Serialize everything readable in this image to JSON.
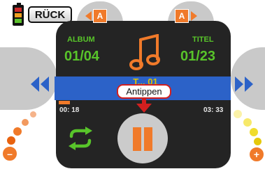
{
  "top": {
    "back_label": "RÜCK",
    "album_nav_label": "A",
    "title_nav_label": "A"
  },
  "info": {
    "album_label": "ALBUM",
    "album_value": "01/04",
    "title_label": "TITEL",
    "title_value": "01/23"
  },
  "track": {
    "title_partial": "T... 01",
    "time_elapsed": "00: 18",
    "time_total": "03: 33",
    "progress_fraction": 0.08
  },
  "annotation": {
    "callout_text": "Antippen"
  },
  "controls": {
    "minus_label": "–",
    "plus_label": "+",
    "volume_left_colors": [
      "#f5b38a",
      "#f29a5f",
      "#f07a2a",
      "#e8620f"
    ],
    "volume_right_colors": [
      "#fbf2a8",
      "#f7e96a",
      "#f0dc2c",
      "#e5c90a"
    ]
  },
  "colors": {
    "accent_green": "#58c42a",
    "accent_orange": "#f07a2a",
    "accent_blue": "#2c62c8",
    "panel_dark": "#242424",
    "callout_red": "#d21f1f",
    "battery_colors": [
      "#cc2a2a",
      "#f0a020",
      "#5cc22c"
    ]
  },
  "icons": [
    "battery-icon",
    "music-note-icon",
    "repeat-icon",
    "pause-icon",
    "rewind-icon",
    "fast-forward-icon",
    "arrow-down-icon",
    "triangle-left-icon",
    "triangle-right-icon"
  ]
}
